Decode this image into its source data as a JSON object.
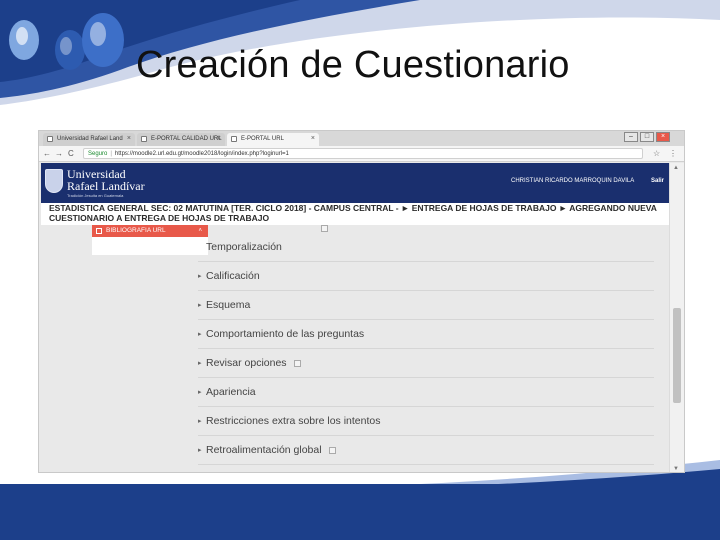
{
  "slide": {
    "title": "Creación de Cuestionario",
    "colors": {
      "band_blue": "#1c3f8a",
      "header_navy": "#1a2f6e",
      "accent_red": "#e8594a"
    }
  },
  "browser": {
    "tabs": [
      {
        "label": "Universidad Rafael Land",
        "close": "×"
      },
      {
        "label": "E-PORTAL CALIDAD URL",
        "close": "×"
      },
      {
        "label": "E-PORTAL URL",
        "close": "×"
      }
    ],
    "window_controls": {
      "minimize": "–",
      "maximize": "□",
      "close": "×"
    },
    "nav": {
      "back": "←",
      "forward": "→",
      "reload": "C"
    },
    "url": {
      "secure_label": "Seguro",
      "address": "https://moodle2.url.edu.gt/moodle2018/login/index.php?loginurl=1",
      "star_icon": "☆",
      "menu_icon": "⋮"
    }
  },
  "site": {
    "logo_line1": "Universidad",
    "logo_line2": "Rafael Landívar",
    "logo_tagline": "Tradición Jesuita en Guatemala",
    "user_name": "CHRISTIAN RICARDO MARROQUIN DAVILA",
    "logout": "Salir"
  },
  "breadcrumb": {
    "line1": "ESTADISTICA GENERAL SEC: 02 MATUTINA [TER. CICLO 2018] - CAMPUS CENTRAL - ► ENTREGA DE HOJAS DE TRABAJO ► AGREGANDO NUEVA",
    "line2": "CUESTIONARIO A ENTREGA DE HOJAS DE TRABAJO"
  },
  "sidebar": {
    "biblio_label": "BIBLIOGRAFIA URL",
    "biblio_caret": "˄"
  },
  "sections": [
    {
      "label": "Temporalización",
      "caret": "▸",
      "help": false,
      "caret_visible": false
    },
    {
      "label": "Calificación",
      "caret": "▸",
      "help": false,
      "caret_visible": true
    },
    {
      "label": "Esquema",
      "caret": "▸",
      "help": false,
      "caret_visible": true
    },
    {
      "label": "Comportamiento de las preguntas",
      "caret": "▸",
      "help": false,
      "caret_visible": true
    },
    {
      "label": "Revisar opciones",
      "caret": "▸",
      "help": true,
      "caret_visible": true
    },
    {
      "label": "Apariencia",
      "caret": "▸",
      "help": false,
      "caret_visible": true
    },
    {
      "label": "Restricciones extra sobre los intentos",
      "caret": "▸",
      "help": false,
      "caret_visible": true
    },
    {
      "label": "Retroalimentación global",
      "caret": "▸",
      "help": true,
      "caret_visible": true
    }
  ],
  "scrollbar": {
    "up": "▲",
    "down": "▼"
  }
}
